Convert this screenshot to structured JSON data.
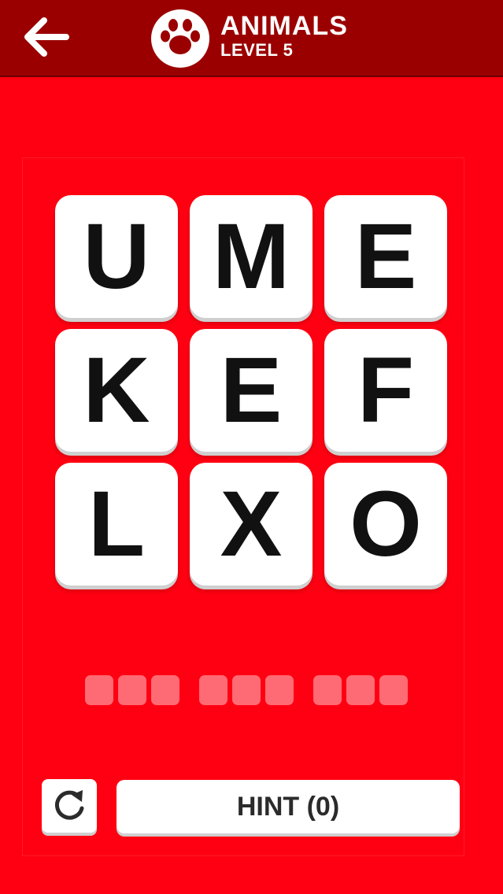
{
  "header": {
    "title": "ANIMALS",
    "subtitle": "LEVEL 5",
    "back_icon": "arrow-left-icon",
    "category_icon": "paw-icon"
  },
  "grid": {
    "tiles": [
      "U",
      "M",
      "E",
      "K",
      "E",
      "F",
      "L",
      "X",
      "O"
    ]
  },
  "answer": {
    "word_lengths": [
      3,
      3,
      3
    ]
  },
  "controls": {
    "reset_icon": "refresh-icon",
    "hint_label": "HINT (0)"
  },
  "colors": {
    "background": "#ff0012",
    "header": "#9b0000",
    "tile": "#ffffff",
    "letter": "#111111"
  }
}
